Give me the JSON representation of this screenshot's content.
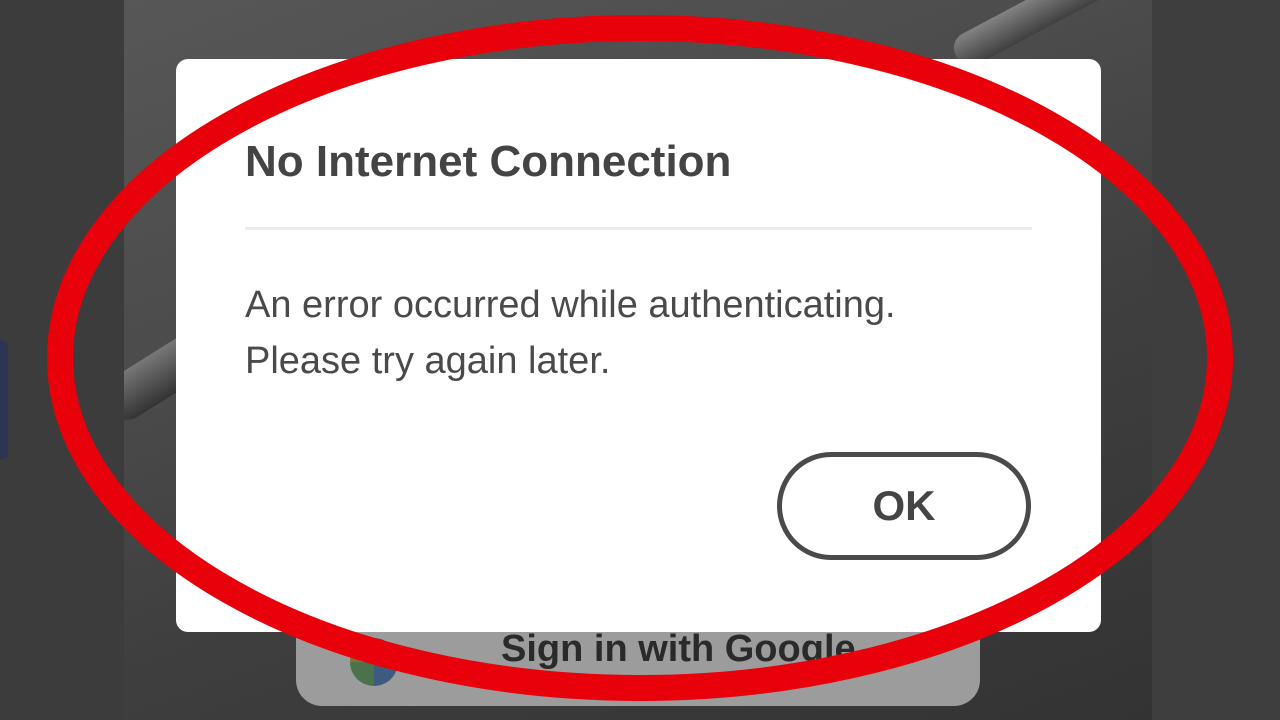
{
  "dialog": {
    "title": "No Internet Connection",
    "message_line1": "An error occurred while authenticating.",
    "message_line2": "Please try again later.",
    "ok_label": "OK"
  },
  "background": {
    "google_button_label": "Sign in with Google",
    "google_icon": "google-logo-icon"
  },
  "annotation": {
    "shape": "ellipse",
    "color": "#e8000b"
  },
  "colors": {
    "dialog_bg": "#ffffff",
    "text": "#444444",
    "overlay": "#3a3a3a"
  }
}
